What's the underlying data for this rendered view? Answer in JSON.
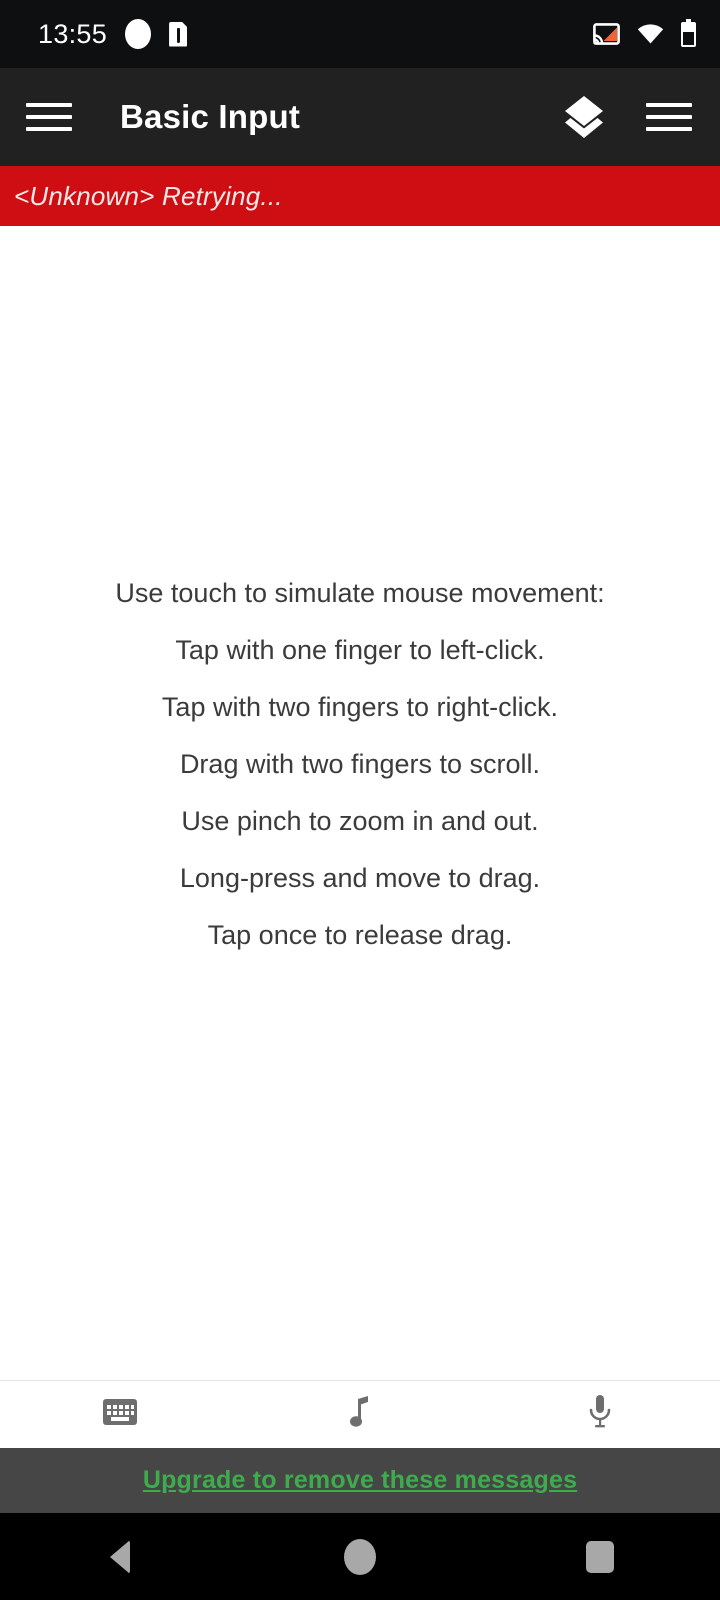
{
  "status_bar": {
    "clock": "13:55",
    "icons_left": [
      "rounded-blob-icon",
      "sdcard-warning-icon"
    ],
    "icons_right": [
      "cast-icon",
      "wifi-icon",
      "battery-icon"
    ],
    "background": "#0e0f11",
    "cast_accent": "#ef6338"
  },
  "app_bar": {
    "title": "Basic Input",
    "menu_icon": "hamburger-icon",
    "layers_icon": "layers-icon",
    "overflow_icon": "hamburger-icon",
    "background": "#212121"
  },
  "alert": {
    "text": "<Unknown> Retrying...",
    "background": "#ce0e12",
    "color": "#fbe9e9"
  },
  "main": {
    "instructions": [
      "Use touch to simulate mouse movement:",
      "Tap with one finger to left-click.",
      "Tap with two fingers to right-click.",
      "Drag with two fingers to scroll.",
      "Use pinch to zoom in and out.",
      "Long-press and move to drag.",
      "Tap once to release drag."
    ],
    "text_color": "#3b3b3b",
    "background": "#ffffff"
  },
  "toolbar": {
    "buttons": [
      {
        "name": "keyboard",
        "icon": "keyboard-icon"
      },
      {
        "name": "music",
        "icon": "music-note-icon"
      },
      {
        "name": "microphone",
        "icon": "microphone-icon"
      }
    ],
    "icon_color": "#6e6e6e"
  },
  "upgrade": {
    "label": "Upgrade to remove these messages",
    "background": "#464646",
    "color": "#3eac4d"
  },
  "nav_bar": {
    "buttons": [
      "back-button",
      "home-button",
      "recents-button"
    ],
    "background": "#000000",
    "icon_color": "#a8a8a8"
  }
}
